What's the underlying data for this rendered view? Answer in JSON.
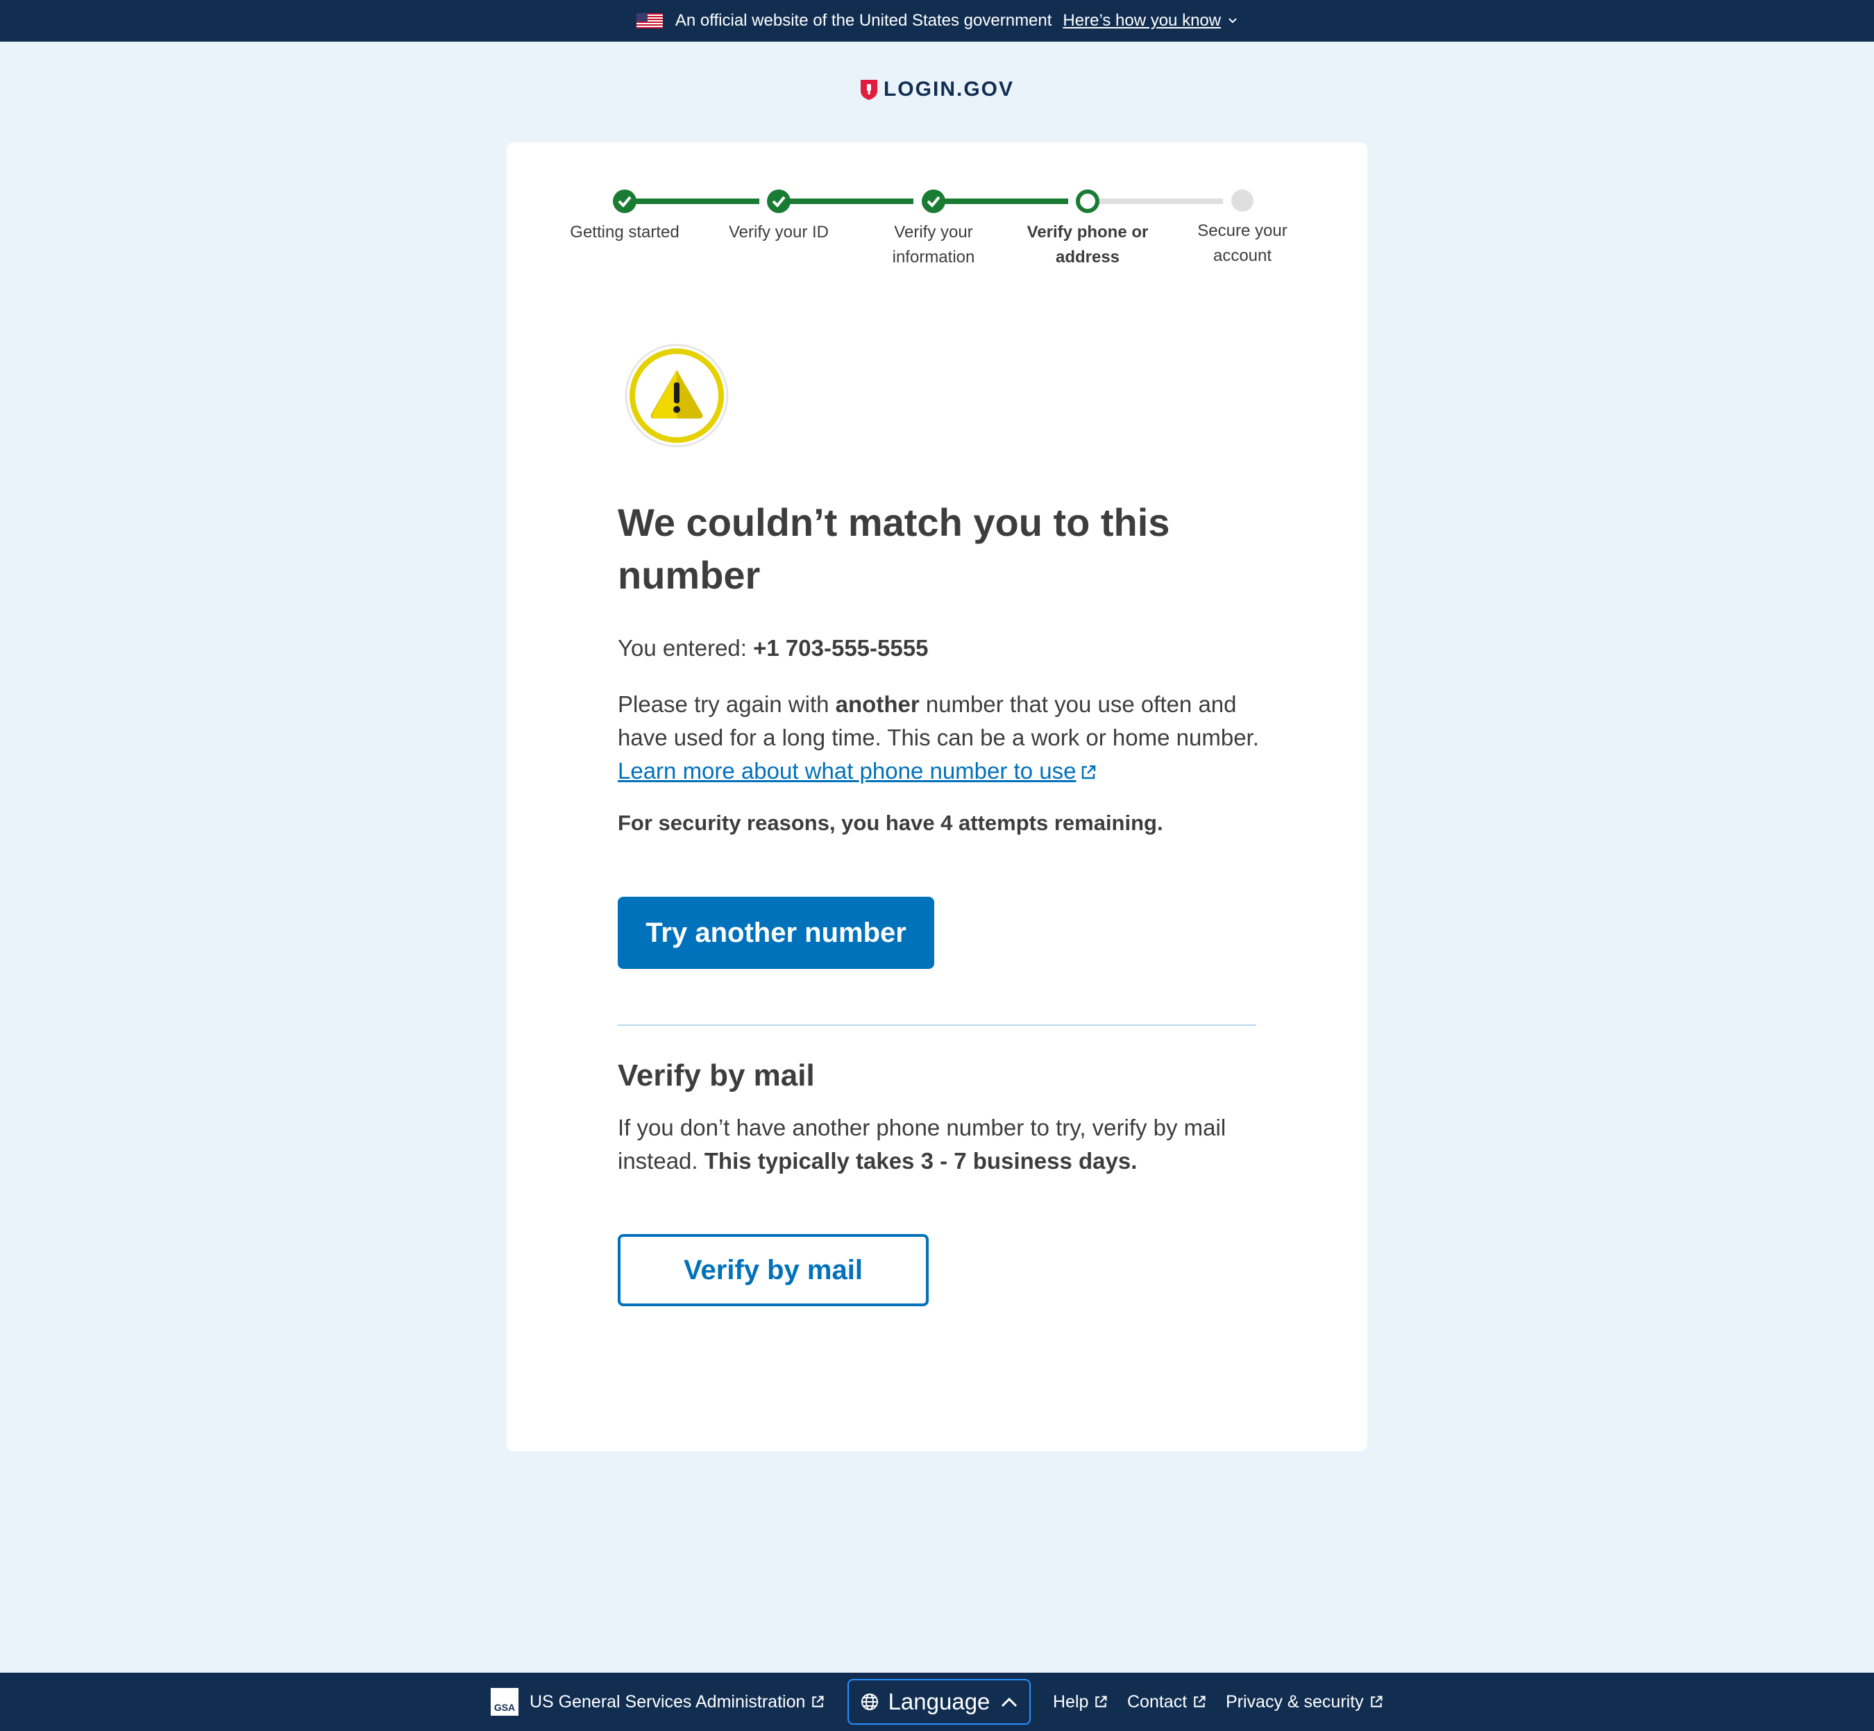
{
  "banner": {
    "text": "An official website of the United States government",
    "link": "Here’s how you know"
  },
  "logo": {
    "text": "LOGIN.GOV"
  },
  "steps": [
    {
      "label": "Getting started",
      "state": "complete"
    },
    {
      "label": "Verify your ID",
      "state": "complete"
    },
    {
      "label": "Verify your information",
      "state": "complete"
    },
    {
      "label": "Verify phone or address",
      "state": "current"
    },
    {
      "label": "Secure your account",
      "state": "incomplete"
    }
  ],
  "main": {
    "heading": "We couldn’t match you to this number",
    "entered_label": "You entered:",
    "entered_value": "+1 703-555-5555",
    "para_pre": "Please try again with",
    "para_bold": "another",
    "para_post": "number that you use often and have used for a long time. This can be a work or home number.",
    "learn_link": "Learn more about what phone number to use",
    "attempts": "For security reasons, you have 4 attempts remaining.",
    "try_button": "Try another number",
    "mail_heading": "Verify by mail",
    "mail_para_pre": "If you don’t have another phone number to try, verify by mail instead.",
    "mail_para_bold": "This typically takes 3 - 7 business days.",
    "mail_button": "Verify by mail"
  },
  "footer": {
    "gsa_logo": "GSA",
    "gsa": "US General Services Administration",
    "language": "Language",
    "help": "Help",
    "contact": "Contact",
    "privacy": "Privacy & security"
  },
  "colors": {
    "banner_bg": "#112e51",
    "page_bg": "#eaf2fa",
    "primary": "#0071bb",
    "success": "#1a7b33",
    "warning": "#e5d000"
  },
  "icons": [
    "us-flag-icon",
    "chevron-down-icon",
    "shield-icon",
    "check-icon",
    "warning-icon",
    "external-link-icon",
    "globe-icon",
    "chevron-up-icon"
  ]
}
